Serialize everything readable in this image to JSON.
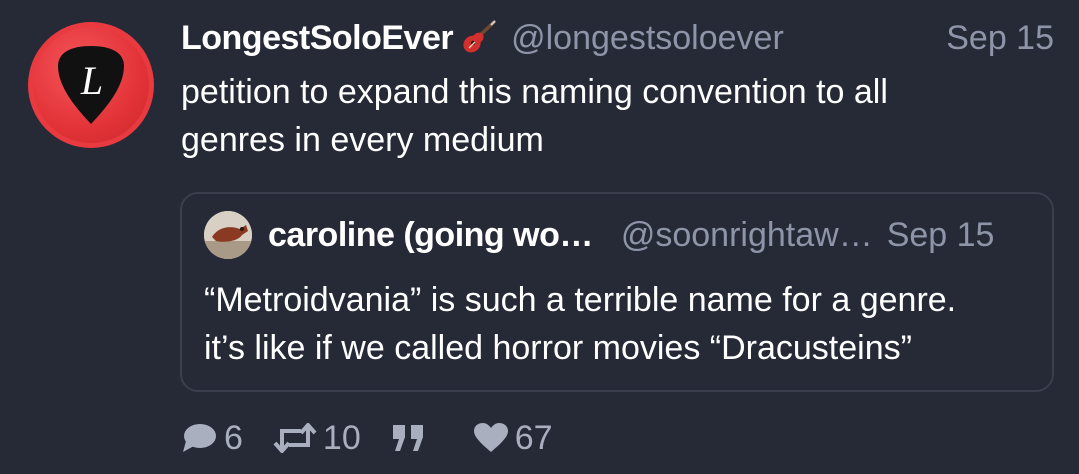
{
  "tweet": {
    "display_name": "LongestSoloEver",
    "name_emoji": "guitar-icon",
    "handle": "@longestsoloever",
    "date": "Sep 15",
    "text_line1": "petition to expand this naming convention to all",
    "text_line2": "genres in every medium",
    "avatar_letter": "L"
  },
  "quote": {
    "display_name": "caroline (going wo…",
    "handle": "@soonrightaw…",
    "date": "Sep 15",
    "text_line1": "“Metroidvania” is such a terrible name for a genre.",
    "text_line2": "it’s like if we called horror movies “Dracusteins”"
  },
  "actions": {
    "replies": "6",
    "retweets": "10",
    "likes": "67"
  },
  "colors": {
    "background": "#262a36",
    "muted": "#8e95a8",
    "avatar_red": "#e83a3f"
  }
}
